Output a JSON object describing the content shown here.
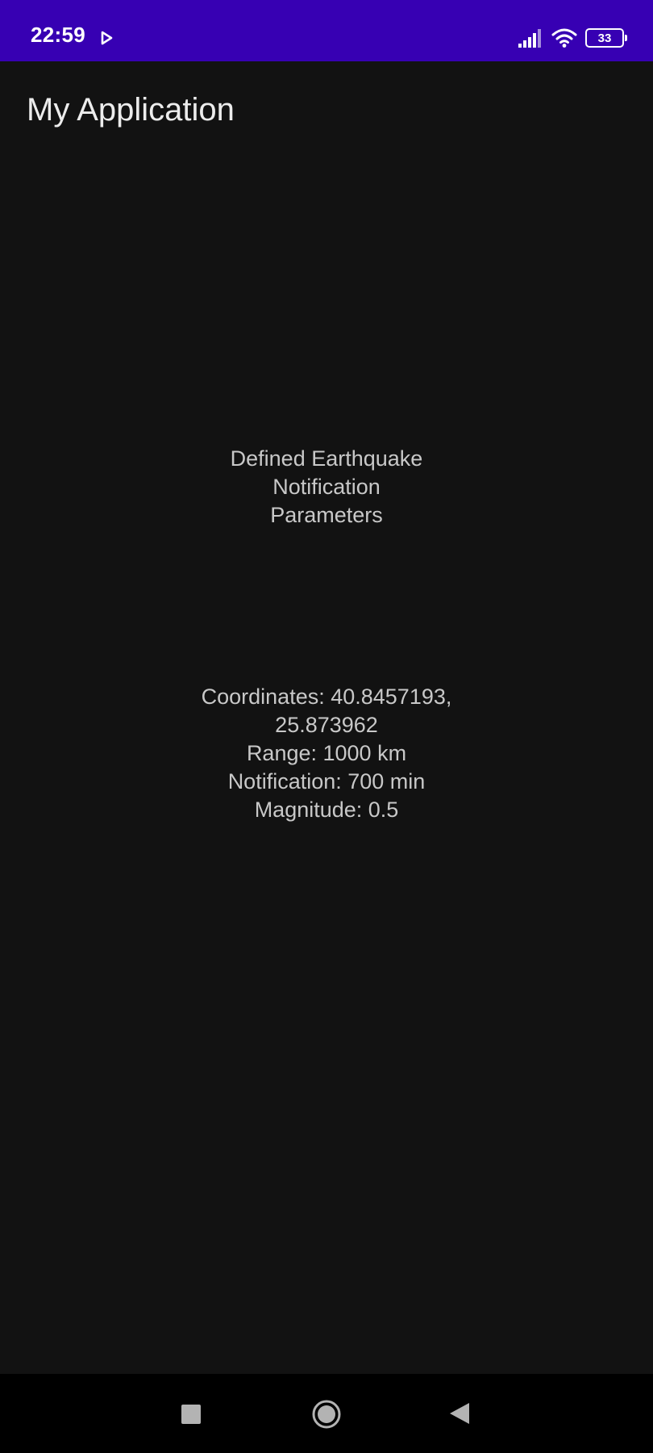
{
  "status_bar": {
    "time": "22:59",
    "battery_level": "33",
    "icons": [
      "play-icon",
      "signal-icon",
      "wifi-icon",
      "battery-icon"
    ],
    "background_color": "#3700b3"
  },
  "app_bar": {
    "title": "My Application"
  },
  "main": {
    "heading_lines": [
      "Defined Earthquake",
      "Notification",
      "Parameters"
    ],
    "params_lines": [
      "Coordinates: 40.8457193,",
      "25.873962",
      "Range: 1000 km",
      "Notification: 700 min",
      "Magnitude: 0.5"
    ]
  },
  "nav_bar": {
    "buttons": [
      "recents-button",
      "home-button",
      "back-button"
    ]
  },
  "colors": {
    "background": "#121212",
    "text": "#c8c8c8",
    "status_bar": "#3700b3",
    "nav_bar": "#000000"
  }
}
